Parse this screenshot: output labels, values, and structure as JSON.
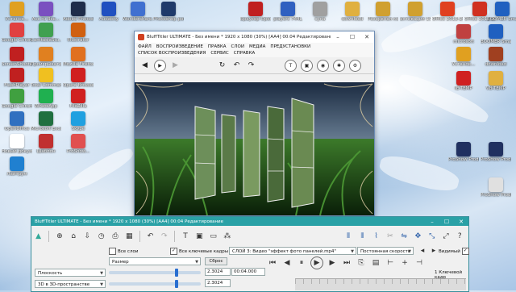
{
  "desktop_icons": [
    {
      "label": "Установ...",
      "color": "#e0a020"
    },
    {
      "label": "Acc.ru Все...",
      "color": "#7a50c0"
    },
    {
      "label": "Adobe Photoshop...",
      "color": "#1f2d4a"
    },
    {
      "label": "Audacity",
      "color": "#2050c0"
    },
    {
      "label": "Wondershare...",
      "color": "#4070d0"
    },
    {
      "label": "Photoshop portable",
      "color": "#1f3a6a"
    },
    {
      "label": "Google Chrome",
      "color": "#e04040"
    },
    {
      "label": "CamtasiaStu...",
      "color": "#40a050"
    },
    {
      "label": "Illustrator",
      "color": "#d06010"
    },
    {
      "label": "ScreenShooter",
      "color": "#c02020"
    },
    {
      "label": "Проигрыватель",
      "color": "#e08020"
    },
    {
      "label": "Mozilla Firefox",
      "color": "#e07020"
    },
    {
      "label": "FlashPlayer",
      "color": "#c02020"
    },
    {
      "label": "Total Commander",
      "color": "#f0c020"
    },
    {
      "label": "Opera Browser",
      "color": "#d02020"
    },
    {
      "label": "Google Chrome",
      "color": "#40a040"
    },
    {
      "label": "WhatsApp",
      "color": "#20b050"
    },
    {
      "label": "FileZilla",
      "color": "#d02020"
    },
    {
      "label": "OpenOffice",
      "color": "#3070c0"
    },
    {
      "label": "Microsoft Excel",
      "color": "#207040"
    },
    {
      "label": "Skype",
      "color": "#20a0e0"
    },
    {
      "label": "Новый документ",
      "color": "#ffffff"
    },
    {
      "label": "Шаблон",
      "color": "#c03030"
    },
    {
      "label": "ProShow...",
      "color": "#e05050"
    },
    {
      "label": "Лайтрум",
      "color": "#2080d0"
    },
    {
      "label": "Браузер Opera",
      "color": "#c02020"
    },
    {
      "label": "plаyers 744L",
      "color": "#3060c0"
    },
    {
      "label": "cyna",
      "color": "#a0a0a0"
    },
    {
      "label": "download",
      "color": "#e0b040"
    },
    {
      "label": "Резервная копия ТР...",
      "color": "#d0a030"
    },
    {
      "label": "активация 19",
      "color": "#d0a030"
    },
    {
      "label": "Office 2013-2019",
      "color": "#e04020"
    },
    {
      "label": "Office 2013-2019",
      "color": "#d03020"
    },
    {
      "label": "BOOMER Smart Tut...",
      "color": "#2060c0"
    },
    {
      "label": "microsoft",
      "color": "#c04040"
    },
    {
      "label": "BOOMER Smart Tu...",
      "color": "#2060c0"
    },
    {
      "label": "Установ...",
      "color": "#e0a020"
    },
    {
      "label": "download",
      "color": "#a04020"
    },
    {
      "label": "IE-TEMP",
      "color": "#d02020"
    },
    {
      "label": "VB-TEMP",
      "color": "#e0b040"
    },
    {
      "label": "ProShow Producer",
      "color": "#203060"
    },
    {
      "label": "ProShow Producer",
      "color": "#203060"
    },
    {
      "label": "ProShow Producer",
      "color": "#e0e0e0"
    }
  ],
  "back_window": {
    "title": "BluffTitler ULTIMATE - Без имени * 1920 x 1080 (30%) [AA4] 00:04 Редактирование",
    "menu": [
      "ФАЙЛ",
      "ВОСПРОИЗВЕДЕНИЕ",
      "ПРАВКА",
      "СЛОИ",
      "МЕДИА",
      "ПРЕДУСТАНОВКИ",
      "СПИСОК ВОСПРОИЗВЕДЕНИЯ",
      "СЕРВИС",
      "СПРАВКА"
    ]
  },
  "front_window": {
    "title": "BluffTitler ULTIMATE - Без имени * 1920 x 1080 (30%) [AA4] 00:04 Редактирование",
    "all_layers_label": "Все слои",
    "all_keyframes_label": "Все ключевые кадры",
    "layer_select": "СЛОЙ 3: Видео \"эффект фото панелей.mp4\"",
    "speed_select": "Постоянная скорость",
    "visible_label": "Видимый",
    "property_select": "Размер",
    "reset_label": "Сброс",
    "plane_select": "Плоскость",
    "space_select": "3D в 3D-пространстве",
    "value1": "2.3024",
    "value2": "2.3024",
    "time_value": "00:04.000",
    "keyframe_label": "1 Ключевой кадр"
  }
}
